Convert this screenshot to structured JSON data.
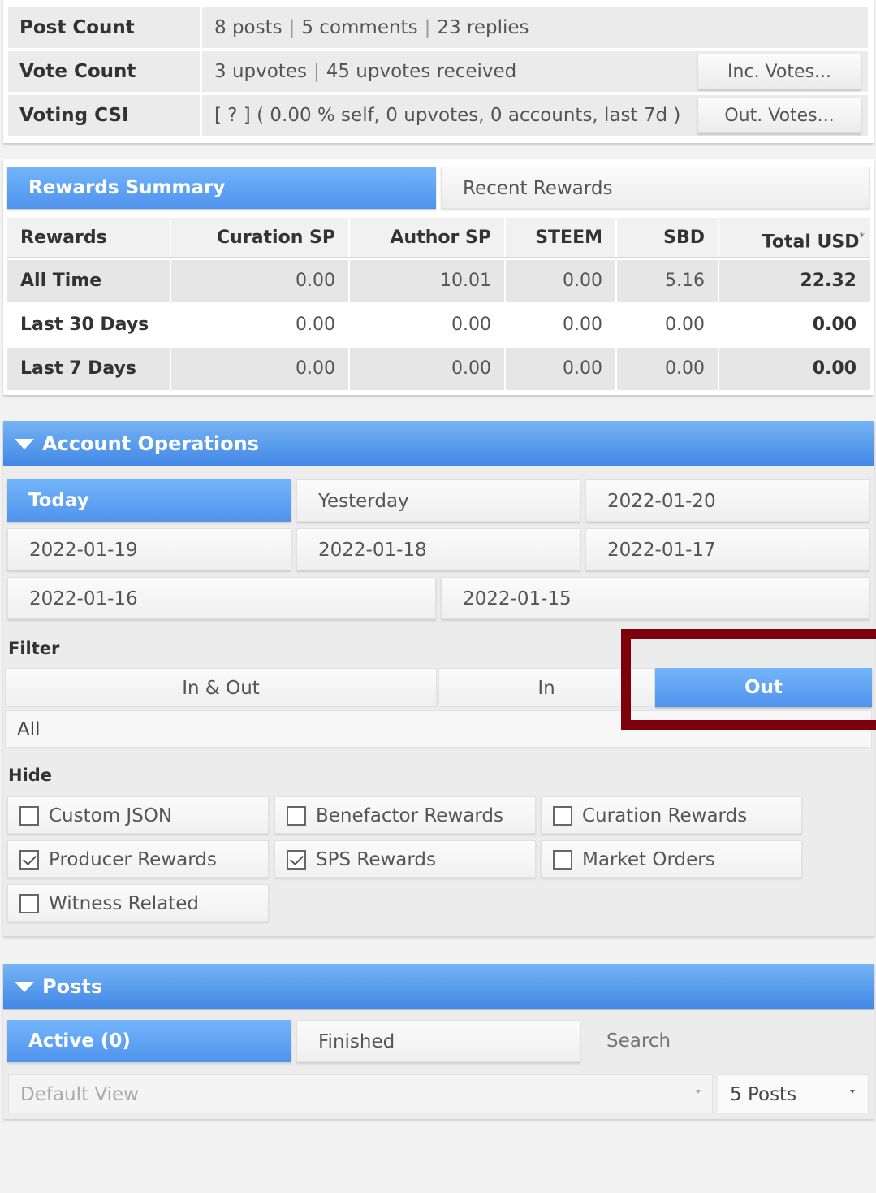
{
  "stats": {
    "post_count": {
      "label": "Post Count",
      "posts": "8 posts",
      "sep1": "|",
      "comments": "5 comments",
      "sep2": "|",
      "replies": "23 replies"
    },
    "vote_count": {
      "label": "Vote Count",
      "upvotes": "3 upvotes",
      "sep": "|",
      "received": "45 upvotes received",
      "button": "Inc. Votes..."
    },
    "voting_csi": {
      "label": "Voting CSI",
      "value": "[ ? ] ( 0.00 % self, 0 upvotes, 0 accounts, last 7d )",
      "button": "Out. Votes..."
    }
  },
  "rewards": {
    "tabs": {
      "summary": "Rewards Summary",
      "recent": "Recent Rewards"
    },
    "headers": {
      "rewards": "Rewards",
      "curation_sp": "Curation SP",
      "author_sp": "Author SP",
      "steem": "STEEM",
      "sbd": "SBD",
      "total_usd": "Total USD",
      "total_usd_mark": "*"
    },
    "rows": [
      {
        "label": "All Time",
        "curation_sp": "0.00",
        "author_sp": "10.01",
        "steem": "0.00",
        "sbd": "5.16",
        "total_usd": "22.32"
      },
      {
        "label": "Last 30 Days",
        "curation_sp": "0.00",
        "author_sp": "0.00",
        "steem": "0.00",
        "sbd": "0.00",
        "total_usd": "0.00"
      },
      {
        "label": "Last 7 Days",
        "curation_sp": "0.00",
        "author_sp": "0.00",
        "steem": "0.00",
        "sbd": "0.00",
        "total_usd": "0.00"
      }
    ]
  },
  "account_ops": {
    "title": "Account Operations",
    "dates": [
      "Today",
      "Yesterday",
      "2022-01-20",
      "2022-01-19",
      "2022-01-18",
      "2022-01-17",
      "2022-01-16",
      "2022-01-15"
    ],
    "filter_label": "Filter",
    "filters": [
      "In & Out",
      "In",
      "Out"
    ],
    "filter_select": "All",
    "hide_label": "Hide",
    "hide_items": [
      {
        "label": "Custom JSON",
        "checked": false
      },
      {
        "label": "Benefactor Rewards",
        "checked": false
      },
      {
        "label": "Curation Rewards",
        "checked": false
      },
      {
        "label": "Producer Rewards",
        "checked": true
      },
      {
        "label": "SPS Rewards",
        "checked": true
      },
      {
        "label": "Market Orders",
        "checked": false
      },
      {
        "label": "Witness Related",
        "checked": false
      }
    ]
  },
  "posts": {
    "title": "Posts",
    "tabs": {
      "active": "Active (0)",
      "finished": "Finished"
    },
    "search_placeholder": "Search",
    "view_select": "Default View",
    "count_select": "5 Posts"
  },
  "colors": {
    "accent": "#4f93ec",
    "highlight": "#7d000a"
  }
}
